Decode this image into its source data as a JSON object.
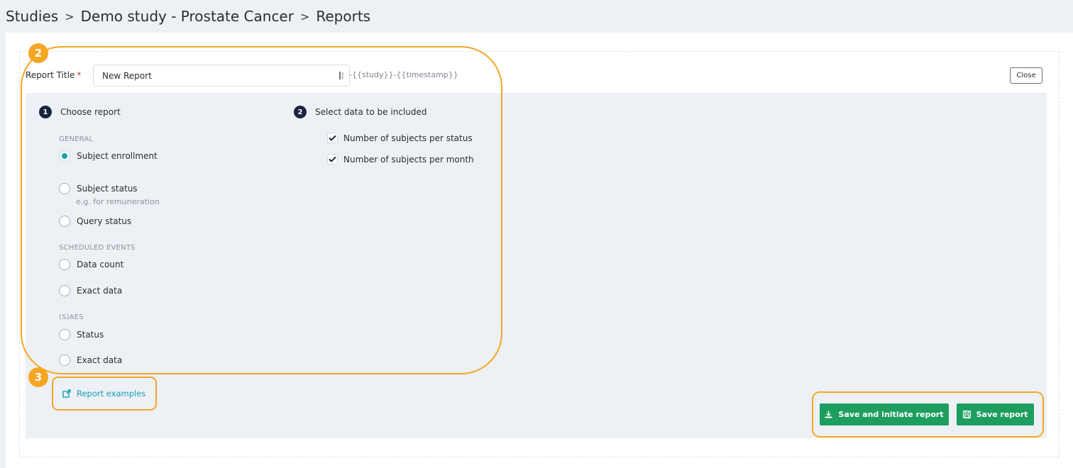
{
  "breadcrumb": {
    "items": [
      "Studies",
      "Demo study - Prostate Cancer",
      "Reports"
    ],
    "separator": ">"
  },
  "report_title": {
    "label": "Report Title",
    "required_mark": "*",
    "value": "New Report",
    "suffix": "-{{study}}-{{timestamp}}"
  },
  "close_label": "Close",
  "step1": {
    "number": "1",
    "label": "Choose report"
  },
  "step2": {
    "number": "2",
    "label": "Select data to be included"
  },
  "groups": {
    "general": "GENERAL",
    "scheduled": "SCHEDULED EVENTS",
    "saes": "(S)AES"
  },
  "options": {
    "subject_enrollment": "Subject enrollment",
    "subject_status": "Subject status",
    "subject_status_hint": "e.g. for remuneration",
    "query_status": "Query status",
    "data_count": "Data count",
    "exact_data_scheduled": "Exact data",
    "sae_status": "Status",
    "exact_data_saes": "Exact data"
  },
  "selected_option": "Subject enrollment",
  "data_options": [
    {
      "label": "Number of subjects per status",
      "checked": true
    },
    {
      "label": "Number of subjects per month",
      "checked": true
    }
  ],
  "report_examples": "Report examples",
  "buttons": {
    "save_initiate": "Save and initiate report",
    "save": "Save report"
  },
  "annotations": {
    "badge2": "2",
    "badge3": "3"
  },
  "colors": {
    "accent_teal": "#1aa3b0",
    "primary_green": "#1e9e5e",
    "highlight_orange": "#f5a623",
    "step_navy": "#1a2540"
  }
}
